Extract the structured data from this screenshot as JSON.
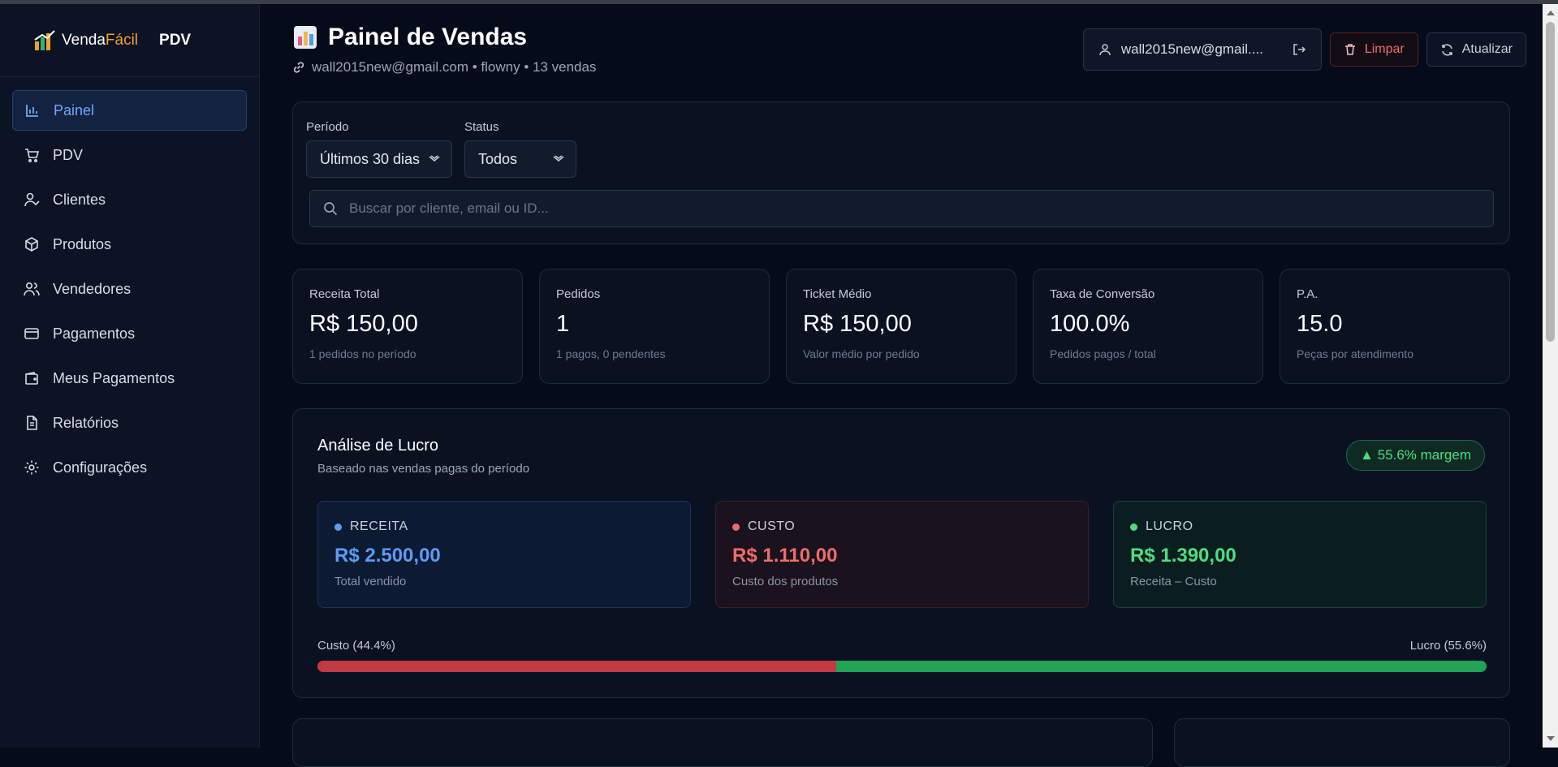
{
  "brand": {
    "logo_prefix": "Venda",
    "logo_suffix": "Fácil",
    "section": "PDV"
  },
  "sidebar": {
    "items": [
      {
        "label": "Painel",
        "icon": "bar-chart-icon",
        "active": true
      },
      {
        "label": "PDV",
        "icon": "cart-icon"
      },
      {
        "label": "Clientes",
        "icon": "user-check-icon"
      },
      {
        "label": "Produtos",
        "icon": "box-icon"
      },
      {
        "label": "Vendedores",
        "icon": "users-icon"
      },
      {
        "label": "Pagamentos",
        "icon": "credit-card-icon"
      },
      {
        "label": "Meus Pagamentos",
        "icon": "wallet-icon"
      },
      {
        "label": "Relatórios",
        "icon": "file-text-icon"
      },
      {
        "label": "Configurações",
        "icon": "gear-icon"
      }
    ]
  },
  "header": {
    "title": "Painel de Vendas",
    "title_icon": "chart-emoji-icon",
    "subtitle": "wall2015new@gmail.com • flowny • 13 vendas",
    "user_email": "wall2015new@gmail....",
    "clear_label": "Limpar",
    "refresh_label": "Atualizar"
  },
  "filters": {
    "period_label": "Período",
    "period_value": "Últimos 30 dias",
    "status_label": "Status",
    "status_value": "Todos",
    "search_placeholder": "Buscar por cliente, email ou ID..."
  },
  "kpis": [
    {
      "label": "Receita Total",
      "value": "R$ 150,00",
      "note": "1 pedidos no período"
    },
    {
      "label": "Pedidos",
      "value": "1",
      "note": "1 pagos, 0 pendentes"
    },
    {
      "label": "Ticket Médio",
      "value": "R$ 150,00",
      "note": "Valor médio por pedido"
    },
    {
      "label": "Taxa de Conversão",
      "value": "100.0%",
      "note": "Pedidos pagos / total"
    },
    {
      "label": "P.A.",
      "value": "15.0",
      "note": "Peças por atendimento"
    }
  ],
  "profit": {
    "title": "Análise de Lucro",
    "subtitle": "Baseado nas vendas pagas do período",
    "margin_badge": "▲ 55.6% margem",
    "revenue": {
      "label": "RECEITA",
      "value": "R$ 2.500,00",
      "note": "Total vendido",
      "color": "#5b9cf5"
    },
    "cost": {
      "label": "CUSTO",
      "value": "R$ 1.110,00",
      "note": "Custo dos produtos",
      "color": "#f16b6b"
    },
    "profit": {
      "label": "LUCRO",
      "value": "R$ 1.390,00",
      "note": "Receita – Custo",
      "color": "#4ade80"
    },
    "cost_bar_label": "Custo (44.4%)",
    "profit_bar_label": "Lucro (55.6%)",
    "cost_share": 0.444,
    "profit_share": 0.556
  },
  "colors": {
    "accent": "#6ea7ff",
    "danger": "#f16b6b",
    "success": "#4ade80",
    "brand_orange": "#f59e2a"
  }
}
